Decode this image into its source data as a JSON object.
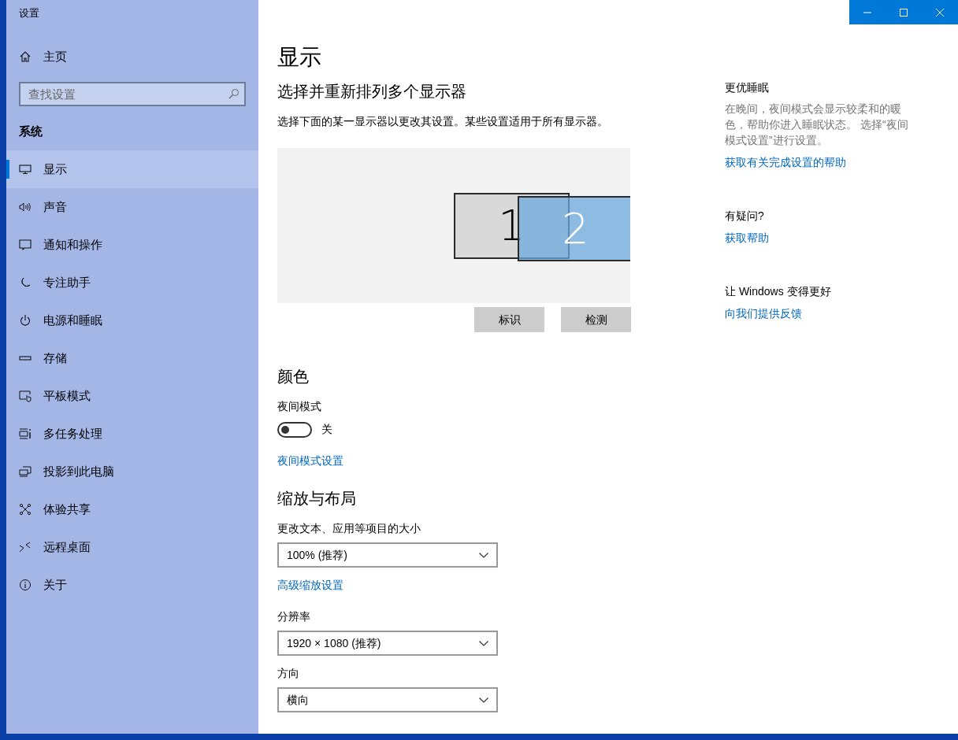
{
  "window": {
    "title": "设置"
  },
  "sidebar": {
    "home": "主页",
    "search": {
      "placeholder": "查找设置"
    },
    "section": "系统",
    "items": [
      {
        "label": "显示",
        "selected": true
      },
      {
        "label": "声音",
        "selected": false
      },
      {
        "label": "通知和操作",
        "selected": false
      },
      {
        "label": "专注助手",
        "selected": false
      },
      {
        "label": "电源和睡眠",
        "selected": false
      },
      {
        "label": "存储",
        "selected": false
      },
      {
        "label": "平板模式",
        "selected": false
      },
      {
        "label": "多任务处理",
        "selected": false
      },
      {
        "label": "投影到此电脑",
        "selected": false
      },
      {
        "label": "体验共享",
        "selected": false
      },
      {
        "label": "远程桌面",
        "selected": false
      },
      {
        "label": "关于",
        "selected": false
      }
    ]
  },
  "main": {
    "title": "显示",
    "arrange_heading": "选择并重新排列多个显示器",
    "arrange_text": "选择下面的某一显示器以更改其设置。某些设置适用于所有显示器。",
    "monitors": [
      {
        "label": "1",
        "selected": false
      },
      {
        "label": "2",
        "selected": true
      }
    ],
    "arrange_buttons": [
      "标识",
      "检测"
    ],
    "color_heading": "颜色",
    "night_label": "夜间模式",
    "night_toggle": {
      "on": false,
      "state_text": "关"
    },
    "night_link": "夜间模式设置",
    "scale_heading": "缩放与布局",
    "dropdowns": [
      {
        "label": "更改文本、应用等项目的大小",
        "value": "100% (推荐)",
        "link": "高级缩放设置"
      },
      {
        "label": "分辨率",
        "value": "1920 × 1080 (推荐)"
      },
      {
        "label": "方向",
        "value": "横向"
      }
    ]
  },
  "aside": [
    {
      "heading": "更优睡眠",
      "text": "在晚间，夜间模式会显示较柔和的暖色，帮助你进入睡眠状态。 选择“夜间模式设置”进行设置。",
      "link": "获取有关完成设置的帮助"
    },
    {
      "heading": "有疑问?",
      "link": "获取帮助"
    },
    {
      "heading": "让 Windows 变得更好",
      "link": "向我们提供反馈"
    }
  ]
}
